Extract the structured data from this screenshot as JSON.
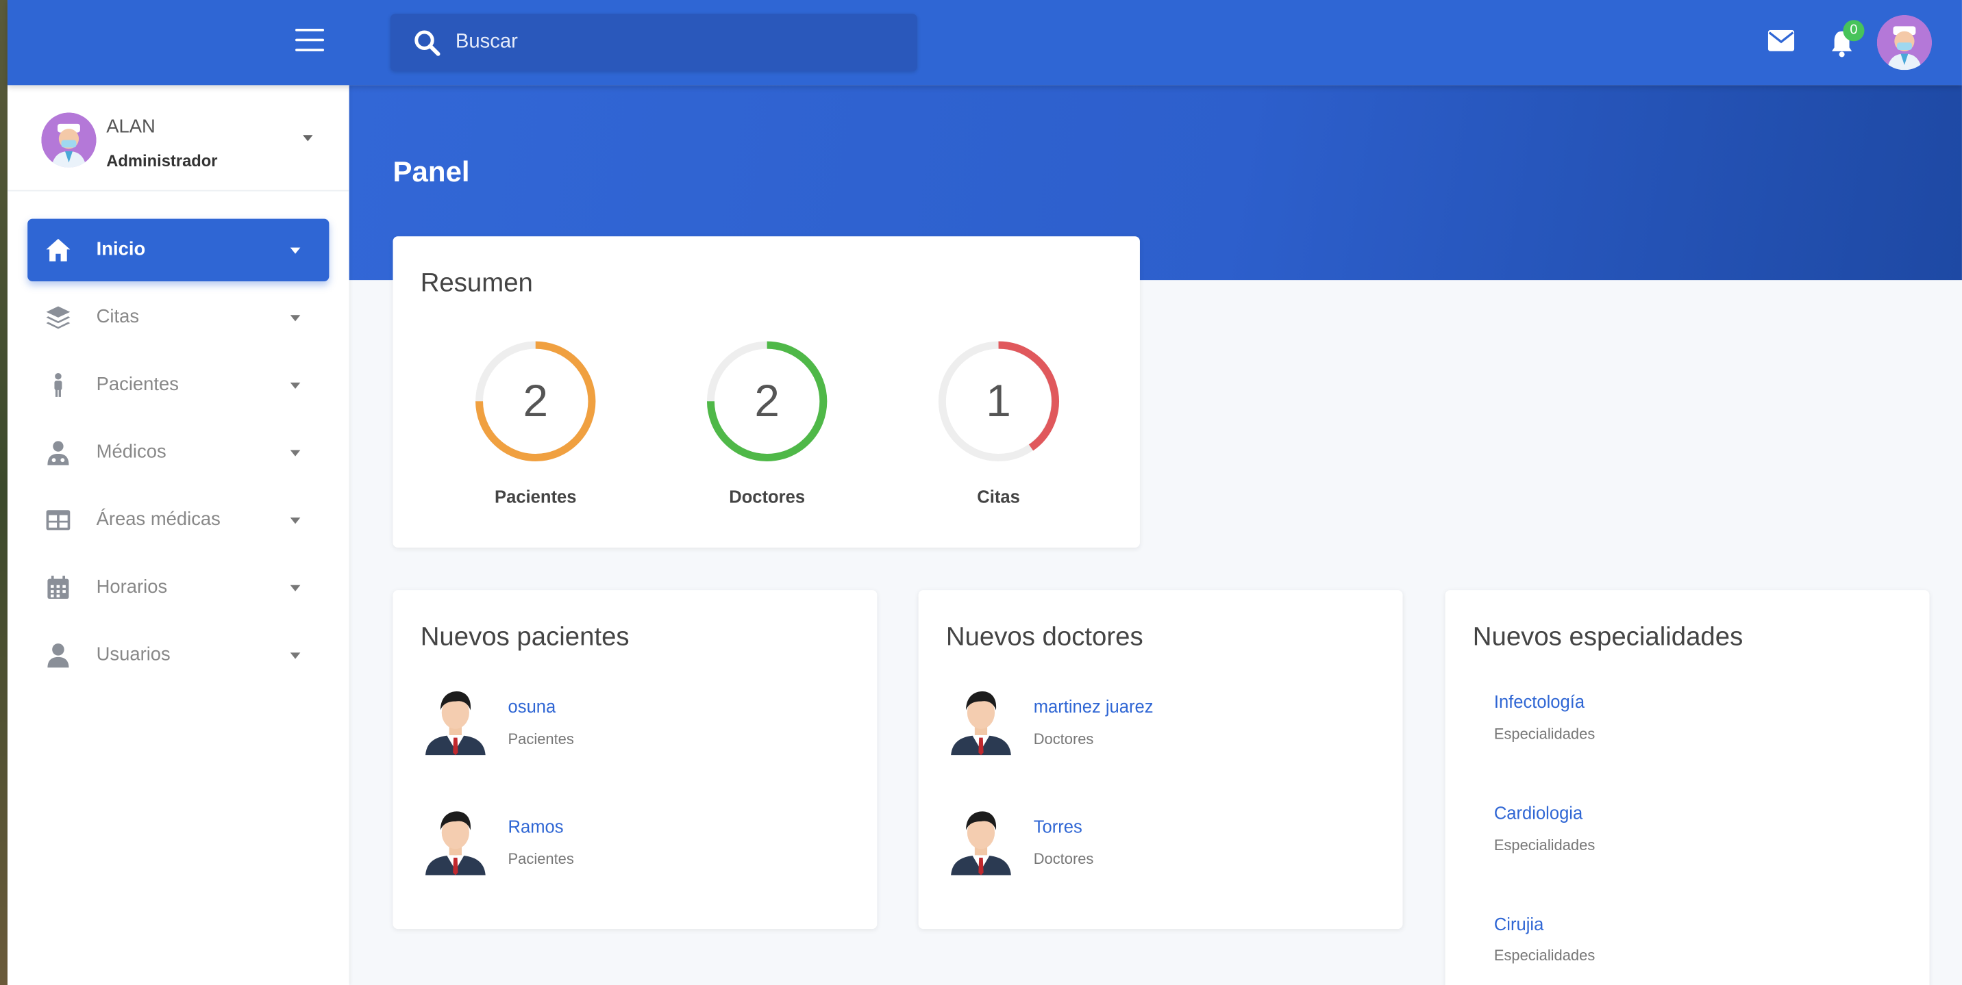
{
  "header": {
    "search_placeholder": "Buscar",
    "notifications_count": "0",
    "icons": [
      "menu-icon",
      "search-icon",
      "envelope-icon",
      "bell-icon",
      "avatar"
    ]
  },
  "user": {
    "name": "ALAN",
    "role": "Administrador"
  },
  "sidebar": {
    "items": [
      {
        "label": "Inicio",
        "icon": "home-icon",
        "active": true
      },
      {
        "label": "Citas",
        "icon": "layers-icon"
      },
      {
        "label": "Pacientes",
        "icon": "person-icon"
      },
      {
        "label": "Médicos",
        "icon": "doctor-icon"
      },
      {
        "label": "Áreas médicas",
        "icon": "table-icon"
      },
      {
        "label": "Horarios",
        "icon": "calendar-icon"
      },
      {
        "label": "Usuarios",
        "icon": "user-icon"
      }
    ]
  },
  "page": {
    "title": "Panel"
  },
  "summary": {
    "title": "Resumen",
    "stats": [
      {
        "value": "2",
        "label": "Pacientes",
        "color": "#f0a040"
      },
      {
        "value": "2",
        "label": "Doctores",
        "color": "#4fb848"
      },
      {
        "value": "1",
        "label": "Citas",
        "color": "#e0585c"
      }
    ]
  },
  "new_patients": {
    "title": "Nuevos pacientes",
    "items": [
      {
        "name": "osuna",
        "sub": "Pacientes"
      },
      {
        "name": "Ramos",
        "sub": "Pacientes"
      }
    ]
  },
  "new_doctors": {
    "title": "Nuevos doctores",
    "items": [
      {
        "name": "martinez juarez",
        "sub": "Doctores"
      },
      {
        "name": "Torres",
        "sub": "Doctores"
      }
    ]
  },
  "new_specialties": {
    "title": "Nuevos especialidades",
    "items": [
      {
        "name": "Infectología",
        "sub": "Especialidades"
      },
      {
        "name": "Cardiologia",
        "sub": "Especialidades"
      },
      {
        "name": "Cirujia",
        "sub": "Especialidades"
      }
    ]
  },
  "colors": {
    "primary": "#2f66d4",
    "badge": "#47c35a"
  }
}
